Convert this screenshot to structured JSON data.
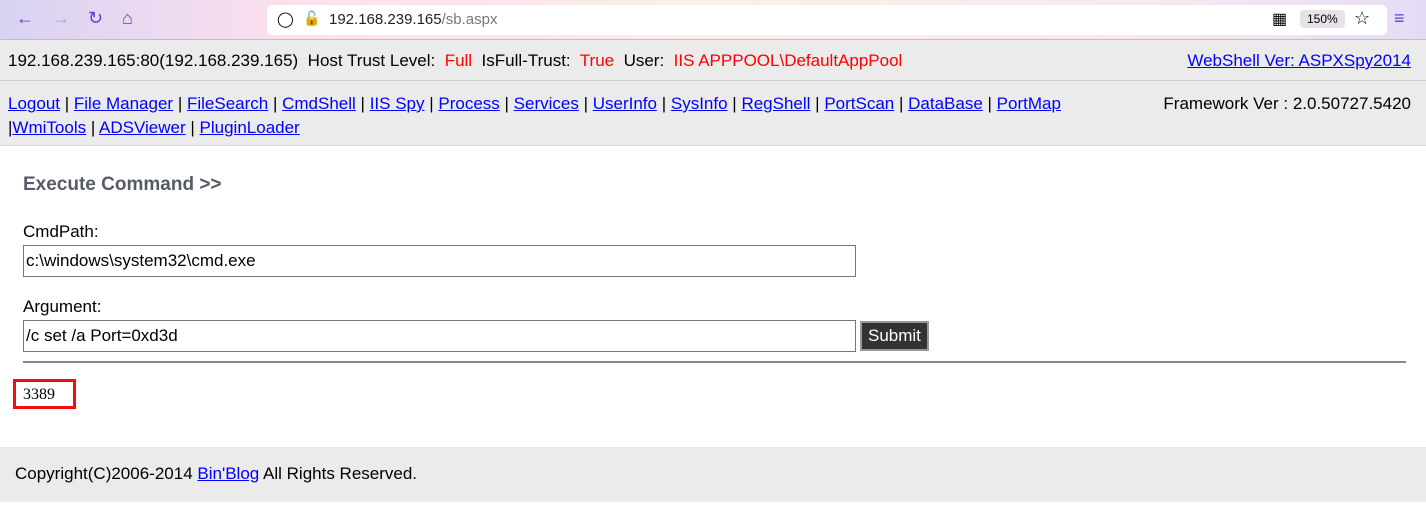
{
  "browser": {
    "url_host": "192.168.239.165",
    "url_path": "/sb.aspx",
    "zoom": "150%",
    "icons": [
      "back-icon",
      "forward-icon",
      "reload-icon",
      "home-icon",
      "shield-icon",
      "insecure-lock-icon",
      "qr-code-icon",
      "star-icon",
      "menu-icon"
    ]
  },
  "info": {
    "host": "192.168.239.165:80(192.168.239.165)",
    "trust_label": "Host Trust Level:",
    "trust_value": "Full",
    "fulltrust_label": "IsFull-Trust:",
    "fulltrust_value": "True",
    "user_label": "User:",
    "user_value": "IIS APPPOOL\\DefaultAppPool",
    "version_link": "WebShell Ver: ASPXSpy2014"
  },
  "nav": {
    "links": [
      "Logout",
      "File Manager",
      "FileSearch",
      "CmdShell",
      "IIS Spy",
      "Process",
      "Services",
      "UserInfo",
      "SysInfo",
      "RegShell",
      "PortScan",
      "DataBase",
      "PortMap",
      "WmiTools",
      "ADSViewer",
      "PluginLoader"
    ],
    "framework": "Framework Ver : 2.0.50727.5420"
  },
  "main": {
    "title": "Execute Command >>",
    "cmdpath_label": "CmdPath:",
    "cmdpath_value": "c:\\windows\\system32\\cmd.exe",
    "argument_label": "Argument:",
    "argument_value": "/c set /a Port=0xd3d",
    "submit": "Submit",
    "output": "3389"
  },
  "footer": {
    "text_pre": "Copyright(C)2006-2014 ",
    "link": "Bin'Blog",
    "text_post": " All Rights Reserved."
  },
  "colors": {
    "highlight_box": "#ee1111",
    "value_red": "#ff0000",
    "link": "#0000ff"
  }
}
